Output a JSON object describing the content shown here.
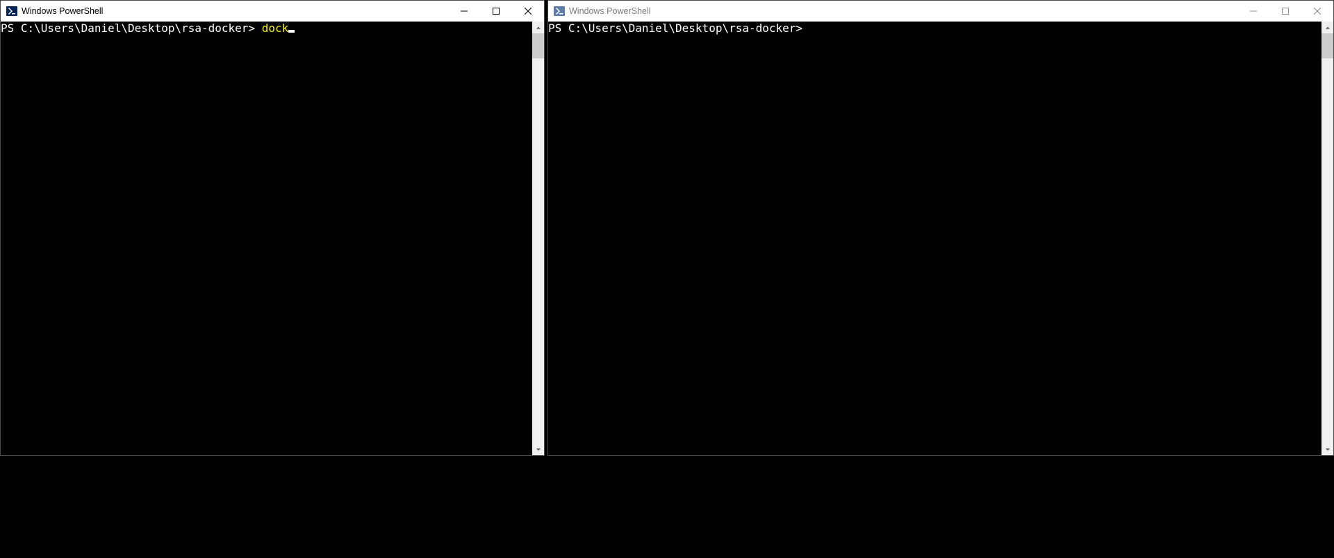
{
  "windows": {
    "left": {
      "title": "Windows PowerShell",
      "active": true,
      "terminal": {
        "prompt": "PS C:\\Users\\Daniel\\Desktop\\rsa-docker> ",
        "command": "dock",
        "cursor_visible": true
      }
    },
    "right": {
      "title": "Windows PowerShell",
      "active": false,
      "terminal": {
        "prompt": "PS C:\\Users\\Daniel\\Desktop\\rsa-docker>",
        "command": "",
        "cursor_visible": false
      }
    }
  },
  "colors": {
    "terminal_bg": "#000000",
    "terminal_fg": "#ffffff",
    "command_fg": "#f9f300",
    "titlebar_bg": "#ffffff"
  }
}
